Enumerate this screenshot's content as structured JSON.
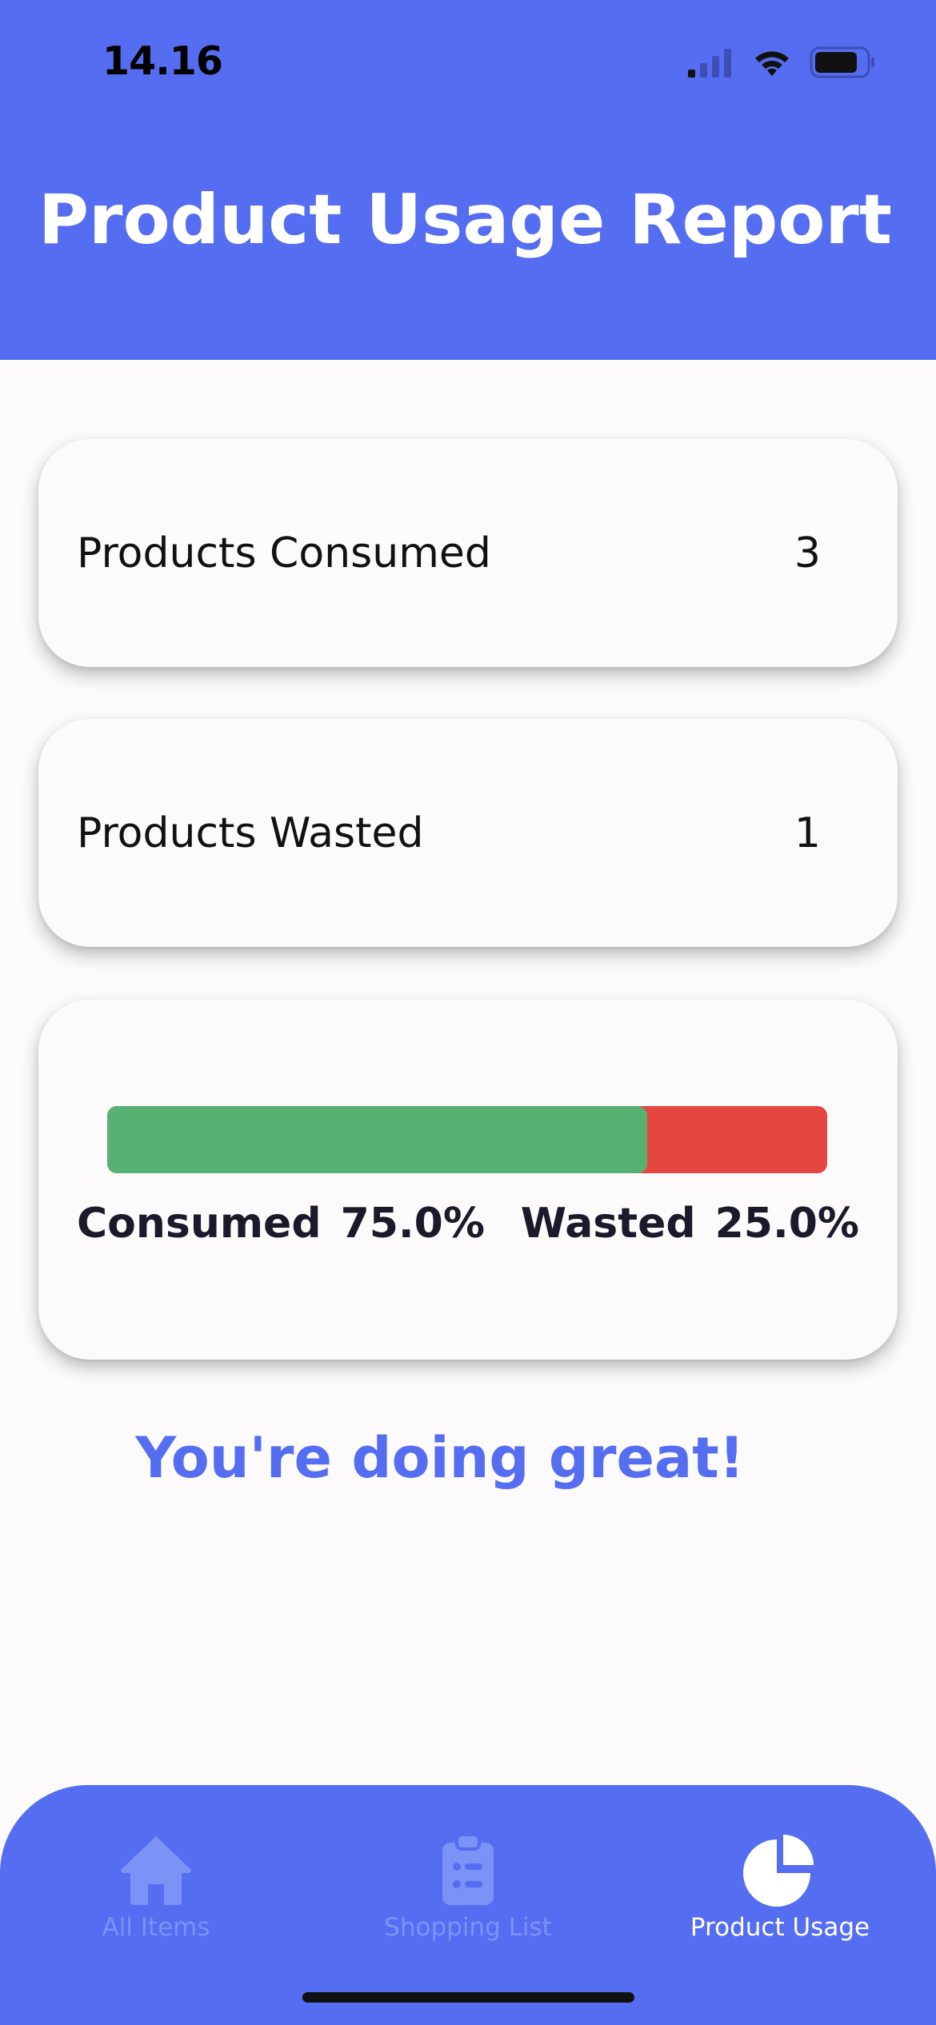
{
  "status_bar": {
    "time": "14.16",
    "icons": [
      "cellular-signal-icon",
      "wifi-icon",
      "battery-icon"
    ]
  },
  "header": {
    "title": "Product Usage Report"
  },
  "stats": {
    "consumed": {
      "label": "Products Consumed",
      "value": "3"
    },
    "wasted": {
      "label": "Products Wasted",
      "value": "1"
    }
  },
  "usage_bar": {
    "consumed_fraction": 0.75,
    "wasted_fraction": 0.25,
    "consumed_label": "Consumed",
    "consumed_percent": "75.0%",
    "wasted_label": "Wasted",
    "wasted_percent": "25.0%",
    "consumed_color": "#57B173",
    "wasted_color": "#E54740"
  },
  "message": "You're doing great!",
  "bottom_nav": {
    "items": [
      {
        "label": "All Items",
        "icon": "home-icon",
        "active": false
      },
      {
        "label": "Shopping List",
        "icon": "clipboard-list-icon",
        "active": false
      },
      {
        "label": "Product Usage",
        "icon": "pie-chart-icon",
        "active": true
      }
    ]
  },
  "colors": {
    "primary": "#556DF1",
    "background": "#FCFAFA",
    "inactive_nav": "#7B92F7"
  }
}
